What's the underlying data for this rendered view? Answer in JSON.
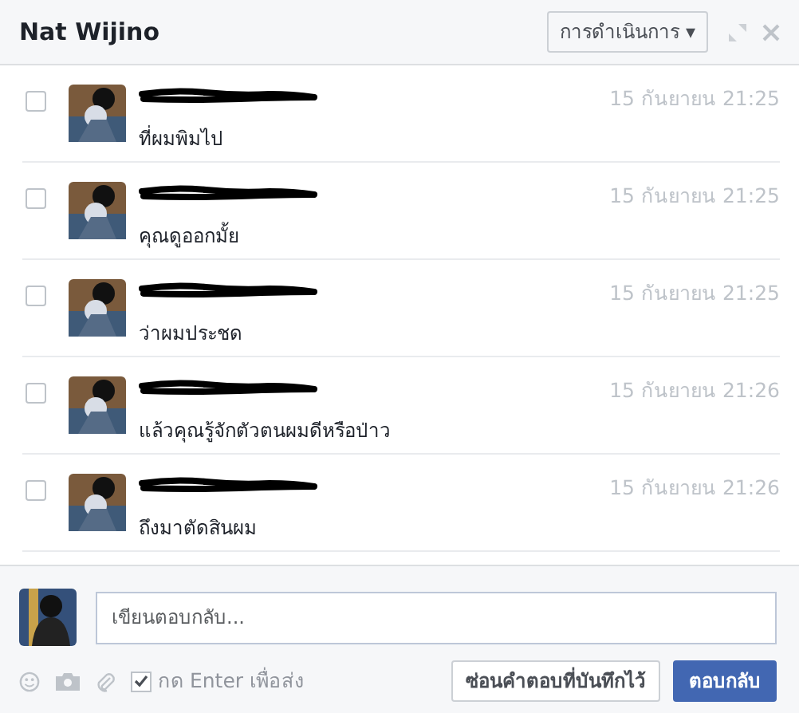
{
  "window": {
    "title": "Nat Wijino",
    "actions_button": "การดำเนินการ ▾"
  },
  "messages": [
    {
      "text": "ที่ผมพิมไป",
      "time": "15 กันยายน 21:25",
      "selected": false
    },
    {
      "text": "คุณดูออกมั้ย",
      "time": "15 กันยายน 21:25",
      "selected": false
    },
    {
      "text": "ว่าผมประชด",
      "time": "15 กันยายน 21:25",
      "selected": false
    },
    {
      "text": "แล้วคุณรู้จักตัวตนผมดีหรือป่าว",
      "time": "15 กันยายน 21:26",
      "selected": false
    },
    {
      "text": "ถึงมาตัดสินผม",
      "time": "15 กันยายน 21:26",
      "selected": false
    }
  ],
  "composer": {
    "placeholder": "เขียนตอบกลับ...",
    "enter_to_send": {
      "label": "กด Enter เพื่อส่ง",
      "checked": true
    },
    "hide_button": "ซ่อนคำตอบที่บันทึกไว้",
    "reply_button": "ตอบกลับ"
  }
}
